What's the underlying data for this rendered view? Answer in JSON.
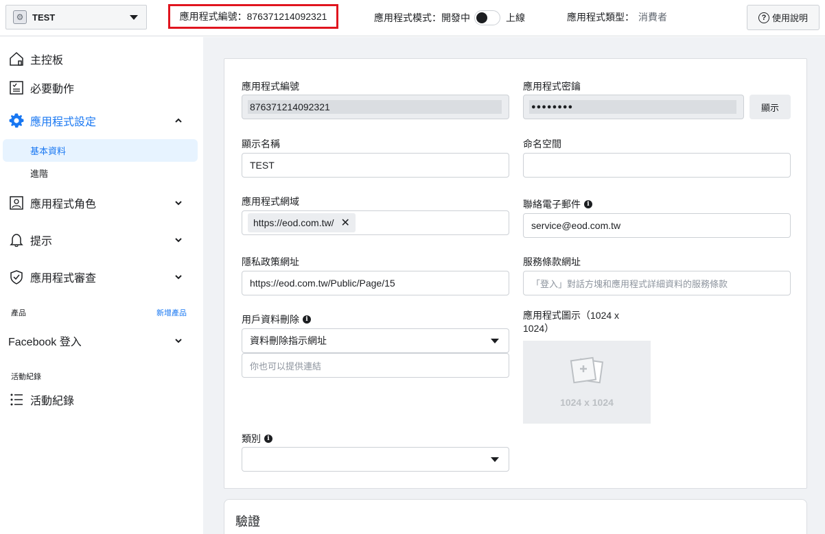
{
  "header": {
    "app_name": "TEST",
    "app_id_text": "應用程式編號：876371214092321",
    "mode_label": "應用程式模式：開發中",
    "mode_live": "上線",
    "type_label": "應用程式類型：",
    "type_value": "消費者",
    "help_label": "使用說明"
  },
  "sidebar": {
    "dashboard": "主控板",
    "required_actions": "必要動作",
    "app_settings": "應用程式設定",
    "basic": "基本資料",
    "advanced": "進階",
    "app_roles": "應用程式角色",
    "alerts": "提示",
    "app_review": "應用程式審查",
    "products_label": "產品",
    "add_product": "新增產品",
    "facebook_login": "Facebook 登入",
    "activity_section": "活動紀錄",
    "activity_log": "活動紀錄"
  },
  "form": {
    "app_id_label": "應用程式編號",
    "app_id_value": "876371214092321",
    "app_secret_label": "應用程式密鑰",
    "app_secret_value": "●●●●●●●●",
    "show_button": "顯示",
    "display_name_label": "顯示名稱",
    "display_name_value": "TEST",
    "namespace_label": "命名空間",
    "namespace_value": "",
    "app_domains_label": "應用程式網域",
    "app_domain_chip": "https://eod.com.tw/",
    "contact_email_label": "聯絡電子郵件",
    "contact_email_value": "service@eod.com.tw",
    "privacy_url_label": "隱私政策網址",
    "privacy_url_value": "https://eod.com.tw/Public/Page/15",
    "tos_url_label": "服務條款網址",
    "tos_url_placeholder": "「登入」對話方塊和應用程式詳細資料的服務條款",
    "data_deletion_label": "用戶資料刪除",
    "data_deletion_select": "資料刪除指示網址",
    "data_deletion_placeholder": "你也可以提供連結",
    "app_icon_label_line1": "應用程式圖示（1024 x",
    "app_icon_label_line2": "1024）",
    "app_icon_size": "1024 x 1024",
    "category_label": "類別",
    "category_value": ""
  },
  "verification": {
    "title": "驗證"
  }
}
